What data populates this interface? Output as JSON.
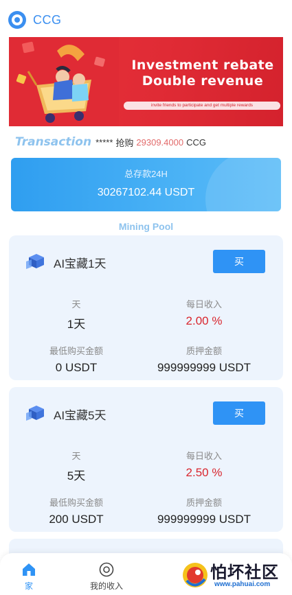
{
  "header": {
    "app_name": "CCG",
    "logo_icon": "ccg-logo-icon"
  },
  "banner": {
    "title_line1": "Investment rebate",
    "title_line2": "Double revenue",
    "subtitle": "invite friends to participate and get multiple rewards"
  },
  "ticker": {
    "label": "Transaction",
    "user": "*****",
    "action": "抢购",
    "amount": "29309.4000",
    "currency": "CCG"
  },
  "deposit": {
    "label": "总存款24H",
    "value": "30267102.44 USDT"
  },
  "section_title": "Mining Pool",
  "pools": [
    {
      "name": "AI宝藏1天",
      "buy_label": "买",
      "days_label": "天",
      "days_value": "1天",
      "daily_label": "每日收入",
      "daily_value": "2.00 %",
      "min_label": "最低购买金额",
      "min_value": "0 USDT",
      "pledge_label": "质押金额",
      "pledge_value": "999999999 USDT"
    },
    {
      "name": "AI宝藏5天",
      "buy_label": "买",
      "days_label": "天",
      "days_value": "5天",
      "daily_label": "每日收入",
      "daily_value": "2.50 %",
      "min_label": "最低购买金额",
      "min_value": "200 USDT",
      "pledge_label": "质押金额",
      "pledge_value": "999999999 USDT"
    }
  ],
  "nav": {
    "items": [
      {
        "label": "家",
        "icon": "home-icon",
        "active": true
      },
      {
        "label": "我的收入",
        "icon": "target-icon",
        "active": false
      }
    ]
  },
  "watermark": {
    "text": "怕坏社区",
    "url": "www.pahuai.com"
  },
  "colors": {
    "accent": "#2f93f5",
    "banner_red": "#e02b35",
    "rate_red": "#d9262e",
    "card_bg": "#edf4fd"
  }
}
